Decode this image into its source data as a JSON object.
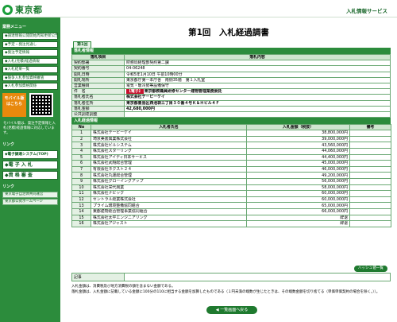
{
  "header": {
    "logo_text": "東京都",
    "right_label": "入札情報サービス"
  },
  "sidebar": {
    "menu_heading": "業務メニュー",
    "items": [
      {
        "label": "◆調達情報公開開始周知更新公告"
      },
      {
        "label": "◆予定・発注見通し"
      },
      {
        "label": "◆発注予定情報"
      },
      {
        "label": "◆入札(見積)経過情報"
      },
      {
        "label": "◆入札結果一覧"
      },
      {
        "label": "◆競争入札参加資格審査"
      },
      {
        "label": "◆入札参加資格関係"
      }
    ],
    "mobile_label": "モバイル版\nはこちら",
    "mobile_note": "モバイル版は、発注予定情報と入札(見積)経過情報に対応しています。",
    "links_heading": "リンク",
    "big_items": [
      {
        "label": "◆電子調達システム(TOP)"
      },
      {
        "label": "◆電 子 入 札"
      },
      {
        "label": "◆資 格 審 査"
      }
    ],
    "links_heading2": "リンク",
    "footer_links": [
      {
        "label": "東京電子自治体共同運営"
      },
      {
        "label": "東京都公式ホームページ"
      }
    ]
  },
  "main": {
    "title": "第1回　入札経過調書",
    "round_tab": "第1回",
    "info_section": "落札者情報",
    "info_headers": [
      "落札項目",
      "落札内容"
    ],
    "info_rows": [
      {
        "k": "契約部署",
        "v": "財務局経理部契約第二課"
      },
      {
        "k": "契約番号",
        "v": "04-06248"
      },
      {
        "k": "開札日時",
        "v": "令和5年1月10日 午前10時00分"
      },
      {
        "k": "開札場所",
        "v": "東京都庁第一本庁舎　南側35階　第１入札室"
      },
      {
        "k": "営業種目",
        "v": "電気・暖冷房等設備保守"
      },
      {
        "k": "件　名",
        "tag": "【電子】",
        "v": "東京都教職員研修センター建物管理業務委託",
        "bold": true
      },
      {
        "k": "落札者氏名",
        "v": "株式会社テーピーケイ",
        "bold": true
      },
      {
        "k": "落札者住所",
        "v": "東京都豊島区西池袋三丁目３０番４号Ｋ＆Ｈビル４Ｆ",
        "bold": true
      },
      {
        "k": "落札金額",
        "v": "42,680,000円",
        "bold": true
      },
      {
        "k": "公共調達調整",
        "v": ""
      }
    ],
    "bid_section": "入札経過情報",
    "bid_headers": [
      "No",
      "入札者氏名",
      "入札金額（税抜）",
      "備考"
    ],
    "bids": [
      {
        "no": "1",
        "name": "株式会社テーピーケイ",
        "amount": "38,800,000円",
        "note": ""
      },
      {
        "no": "2",
        "name": "埼京美装興業株式会社",
        "amount": "39,000,000円",
        "note": ""
      },
      {
        "no": "3",
        "name": "株式会社ビルシステム",
        "amount": "43,560,000円",
        "note": ""
      },
      {
        "no": "4",
        "name": "株式会社スターリング",
        "amount": "44,060,000円",
        "note": ""
      },
      {
        "no": "5",
        "name": "株式会社アイディ日本サービス",
        "amount": "44,400,000円",
        "note": ""
      },
      {
        "no": "6",
        "name": "株式会社武翔総合管理",
        "amount": "45,000,000円",
        "note": ""
      },
      {
        "no": "7",
        "name": "有限会社ネクスト２４",
        "amount": "46,000,000円",
        "note": ""
      },
      {
        "no": "8",
        "name": "株式会社丸運総合管理",
        "amount": "49,200,000円",
        "note": ""
      },
      {
        "no": "9",
        "name": "株式会社グローイングアップ",
        "amount": "56,000,000円",
        "note": ""
      },
      {
        "no": "10",
        "name": "株式会社栄代興業",
        "amount": "58,000,000円",
        "note": ""
      },
      {
        "no": "11",
        "name": "株式会社ナビック",
        "amount": "60,000,000円",
        "note": ""
      },
      {
        "no": "12",
        "name": "セントラル総業株式会社",
        "amount": "60,000,000円",
        "note": ""
      },
      {
        "no": "13",
        "name": "プライム環境整備協同組合",
        "amount": "65,000,000円",
        "note": ""
      },
      {
        "no": "14",
        "name": "東都建物総合管理事業協同組合",
        "amount": "66,000,000円",
        "note": ""
      },
      {
        "no": "15",
        "name": "株式会社太平エンジニアリング",
        "amount": "辞退",
        "note": ""
      },
      {
        "no": "16",
        "name": "株式会社アジャスト",
        "amount": "辞退",
        "note": ""
      }
    ],
    "remarks_button": "ハッシュ値一覧",
    "memo_label": "記事",
    "footnote": "入札金額は、消費税及び地方消費税の額を含まない金額である。\n落札金額は、入札金額に記載している金額に100分の110に相当する金額を加算したものである（１円未満の端数が生じたときは、その端数金額を切り捨てる（単価単価契約の場合を除く。））。",
    "back_button": "◀ 一覧画面へ戻る"
  }
}
